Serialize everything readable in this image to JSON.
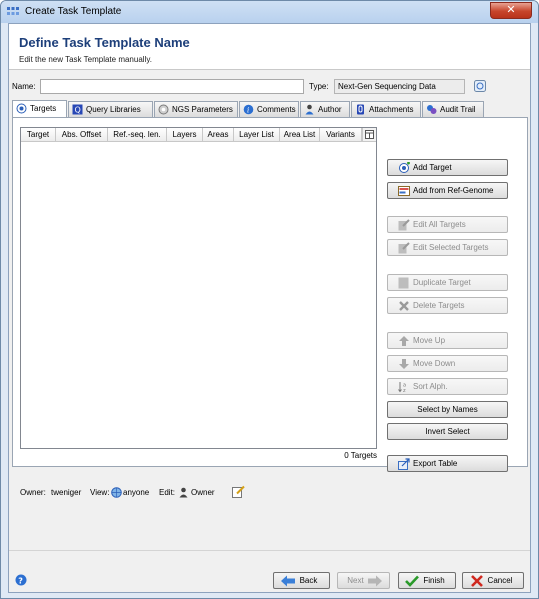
{
  "window": {
    "title": "Create Task Template",
    "close_glyph": "✕"
  },
  "header": {
    "title": "Define Task Template Name",
    "subtitle": "Edit the new Task Template manually."
  },
  "form": {
    "name_label": "Name:",
    "name_value": "",
    "type_label": "Type:",
    "type_value": "Next-Gen Sequencing Data"
  },
  "tabs": [
    {
      "label": "Targets",
      "icon": "target-icon",
      "active": true
    },
    {
      "label": "Query Libraries",
      "icon": "query-library-icon"
    },
    {
      "label": "NGS Parameters",
      "icon": "gear-icon"
    },
    {
      "label": "Comments",
      "icon": "info-icon"
    },
    {
      "label": "Author",
      "icon": "person-icon"
    },
    {
      "label": "Attachments",
      "icon": "paperclip-icon"
    },
    {
      "label": "Audit Trail",
      "icon": "audit-trail-icon"
    }
  ],
  "table": {
    "columns": [
      "Target",
      "Abs. Offset",
      "Ref.-seq. len.",
      "Layers",
      "Areas",
      "Layer List",
      "Area List",
      "Variants"
    ],
    "rows": [],
    "count_label": "0 Targets"
  },
  "buttons": {
    "add_target": "Add Target",
    "add_from_ref": "Add from Ref-Genome",
    "edit_all": "Edit All Targets",
    "edit_selected": "Edit Selected Targets",
    "duplicate": "Duplicate Target",
    "delete": "Delete Targets",
    "move_up": "Move Up",
    "move_down": "Move Down",
    "sort_alph": "Sort Alph.",
    "select_by_names": "Select by Names",
    "invert_select": "Invert Select",
    "export_table": "Export Table"
  },
  "owner": {
    "owner_label": "Owner:",
    "owner_value": "tweniger",
    "view_label": "View:",
    "view_value": "anyone",
    "edit_label": "Edit:",
    "edit_value": "Owner"
  },
  "footer": {
    "back": "Back",
    "next": "Next",
    "finish": "Finish",
    "cancel": "Cancel"
  }
}
